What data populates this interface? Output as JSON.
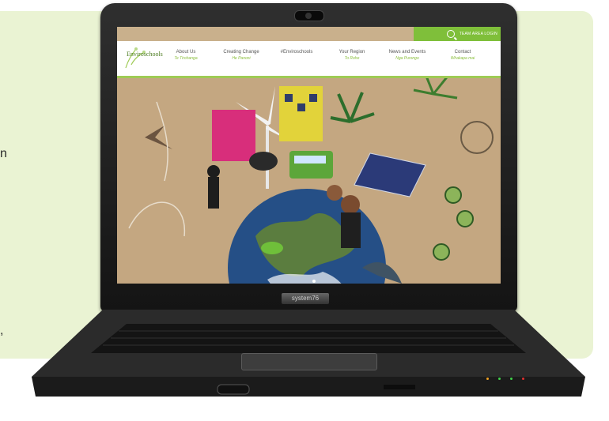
{
  "edge_text": {
    "letter_top": "n",
    "letter_bottom": ","
  },
  "site": {
    "logo_text": "Enviroschools",
    "team_link": "TEAM AREA LOGIN",
    "nav": [
      {
        "label": "About Us",
        "sub": "Te Tirohanga"
      },
      {
        "label": "Creating Change",
        "sub": "He Panoni"
      },
      {
        "label": "#Enviroschools",
        "sub": ""
      },
      {
        "label": "Your Region",
        "sub": "To Rohe"
      },
      {
        "label": "News and Events",
        "sub": "Nga Purongo"
      },
      {
        "label": "Contact",
        "sub": "Whakapa mai"
      }
    ]
  },
  "laptop": {
    "brand": "system76"
  },
  "colors": {
    "panel_bg": "#eaf3d3",
    "accent_green": "#7fbf3a",
    "nav_border": "#9fcb55"
  }
}
